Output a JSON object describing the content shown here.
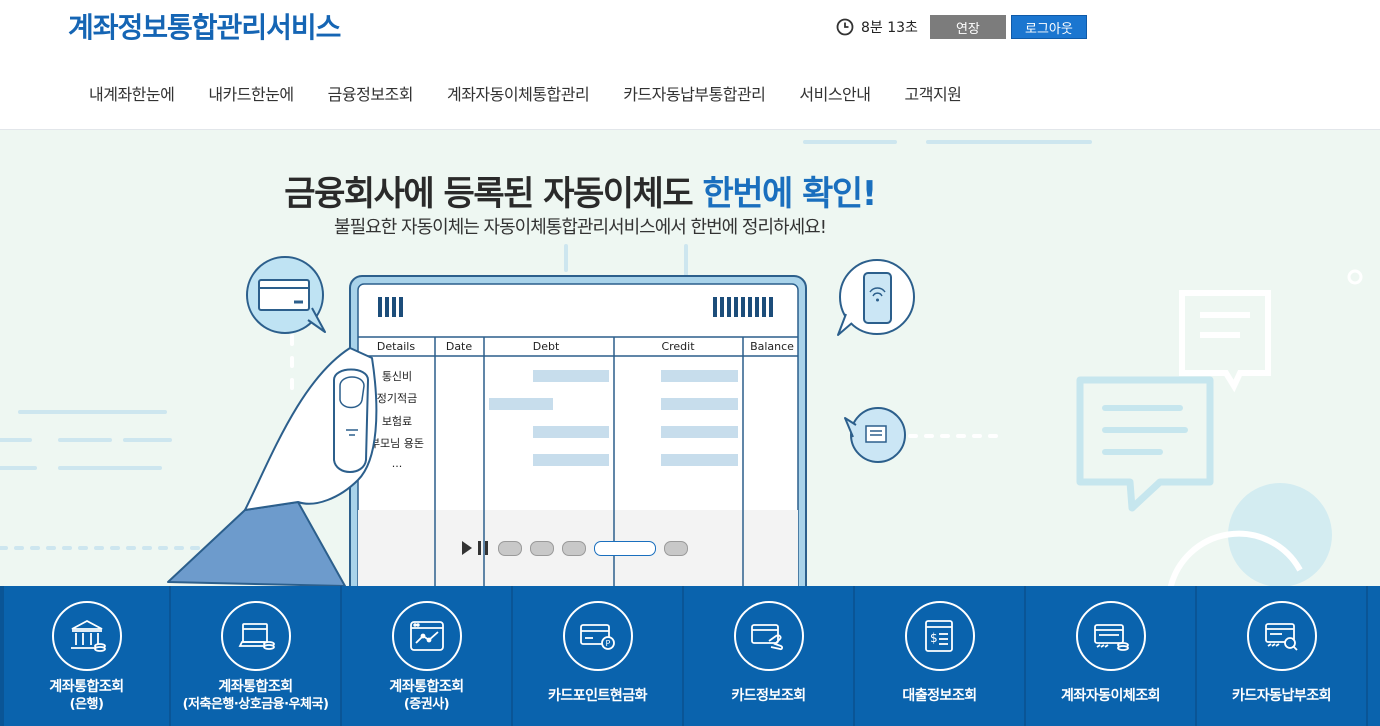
{
  "header": {
    "brand": "계좌정보통합관리서비스",
    "session_timer": "8분 13초",
    "extend_label": "연장",
    "logout_label": "로그아웃"
  },
  "nav": {
    "items": [
      "내계좌한눈에",
      "내카드한눈에",
      "금융정보조회",
      "계좌자동이체통합관리",
      "카드자동납부통합관리",
      "서비스안내",
      "고객지원"
    ]
  },
  "hero": {
    "title_main": "금융회사에 등록된 자동이체도 ",
    "title_accent": "한번에 확인!",
    "subtitle": "불필요한 자동이체는 자동이체통합관리서비스에서 한번에 정리하세요!",
    "table_headers": [
      "Details",
      "Date",
      "Debt",
      "Credit",
      "Balance"
    ],
    "table_rows": [
      "통신비",
      "정기적금",
      "보험료",
      "부모님 용돈",
      "..."
    ],
    "accent_color": "#1a6fbe"
  },
  "slider": {
    "slide_count": 5,
    "active_index": 3
  },
  "quick_menu": [
    {
      "icon": "bank-icon",
      "label": "계좌통합조회",
      "sub": "(은행)"
    },
    {
      "icon": "savings-bank-icon",
      "label": "계좌통합조회",
      "sub": "(저축은행·상호금융·우체국)"
    },
    {
      "icon": "stock-chart-icon",
      "label": "계좌통합조회",
      "sub": "(증권사)"
    },
    {
      "icon": "card-point-icon",
      "label": "카드포인트현금화",
      "sub": ""
    },
    {
      "icon": "card-hand-icon",
      "label": "카드정보조회",
      "sub": ""
    },
    {
      "icon": "loan-document-icon",
      "label": "대출정보조회",
      "sub": ""
    },
    {
      "icon": "auto-transfer-icon",
      "label": "계좌자동이체조회",
      "sub": ""
    },
    {
      "icon": "card-search-icon",
      "label": "카드자동납부조회",
      "sub": ""
    }
  ]
}
